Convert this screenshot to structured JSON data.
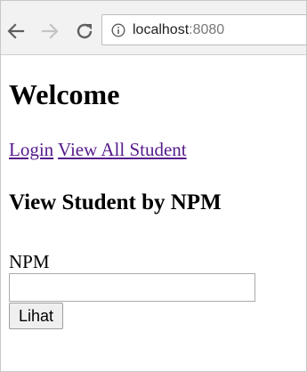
{
  "browser": {
    "url_host": "localhost",
    "url_port": ":8080"
  },
  "page": {
    "title": "Welcome",
    "nav_links": [
      {
        "label": "Login"
      },
      {
        "label": "View All Student"
      }
    ],
    "section_title": "View Student by NPM",
    "form": {
      "field_label": "NPM",
      "field_value": "",
      "submit_label": "Lihat"
    }
  },
  "colors": {
    "visited_link": "#551a8b",
    "toolbar_bg": "#f2f2f2"
  }
}
